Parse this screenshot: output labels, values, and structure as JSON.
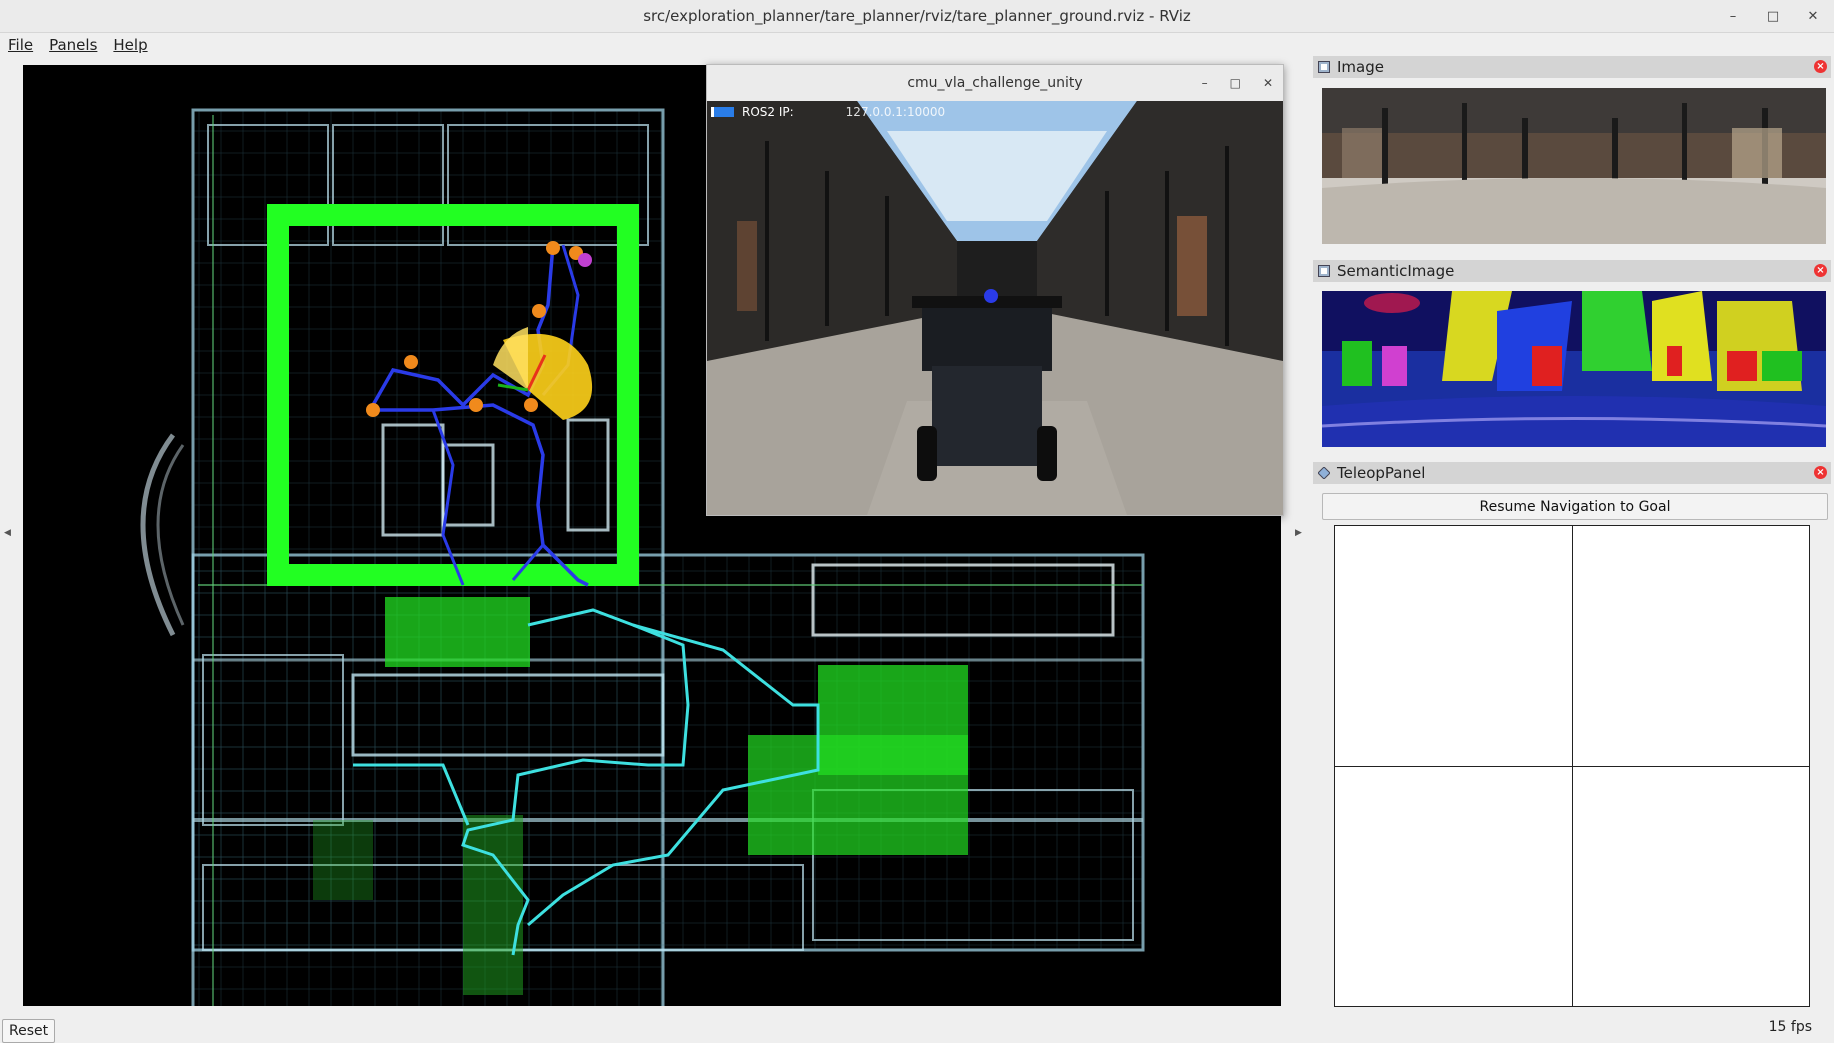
{
  "window": {
    "title": "src/exploration_planner/tare_planner/rviz/tare_planner_ground.rviz - RViz"
  },
  "menu": {
    "file": "File",
    "panels": "Panels",
    "help": "Help"
  },
  "unity_window": {
    "title": "cmu_vla_challenge_unity",
    "ros_label": "ROS2 IP:",
    "ros_ip": "127.0.0.1:10000"
  },
  "panels": {
    "image": {
      "title": "Image"
    },
    "semantic": {
      "title": "SemanticImage"
    },
    "teleop": {
      "title": "TeleopPanel",
      "resume_label": "Resume Navigation to Goal"
    }
  },
  "status": {
    "reset_label": "Reset",
    "fps": "15 fps"
  },
  "colors": {
    "explored_green": "#22ff22",
    "path_blue": "#2a3be8",
    "path_cyan": "#3ee0e0",
    "waypoint_orange": "#f08a1c",
    "scan_yellow": "#ffd21a"
  },
  "icons": {
    "minimize": "minimize-icon",
    "maximize": "maximize-icon",
    "close": "close-icon",
    "image_panel": "image-icon",
    "teleop_panel": "diamond-icon"
  }
}
